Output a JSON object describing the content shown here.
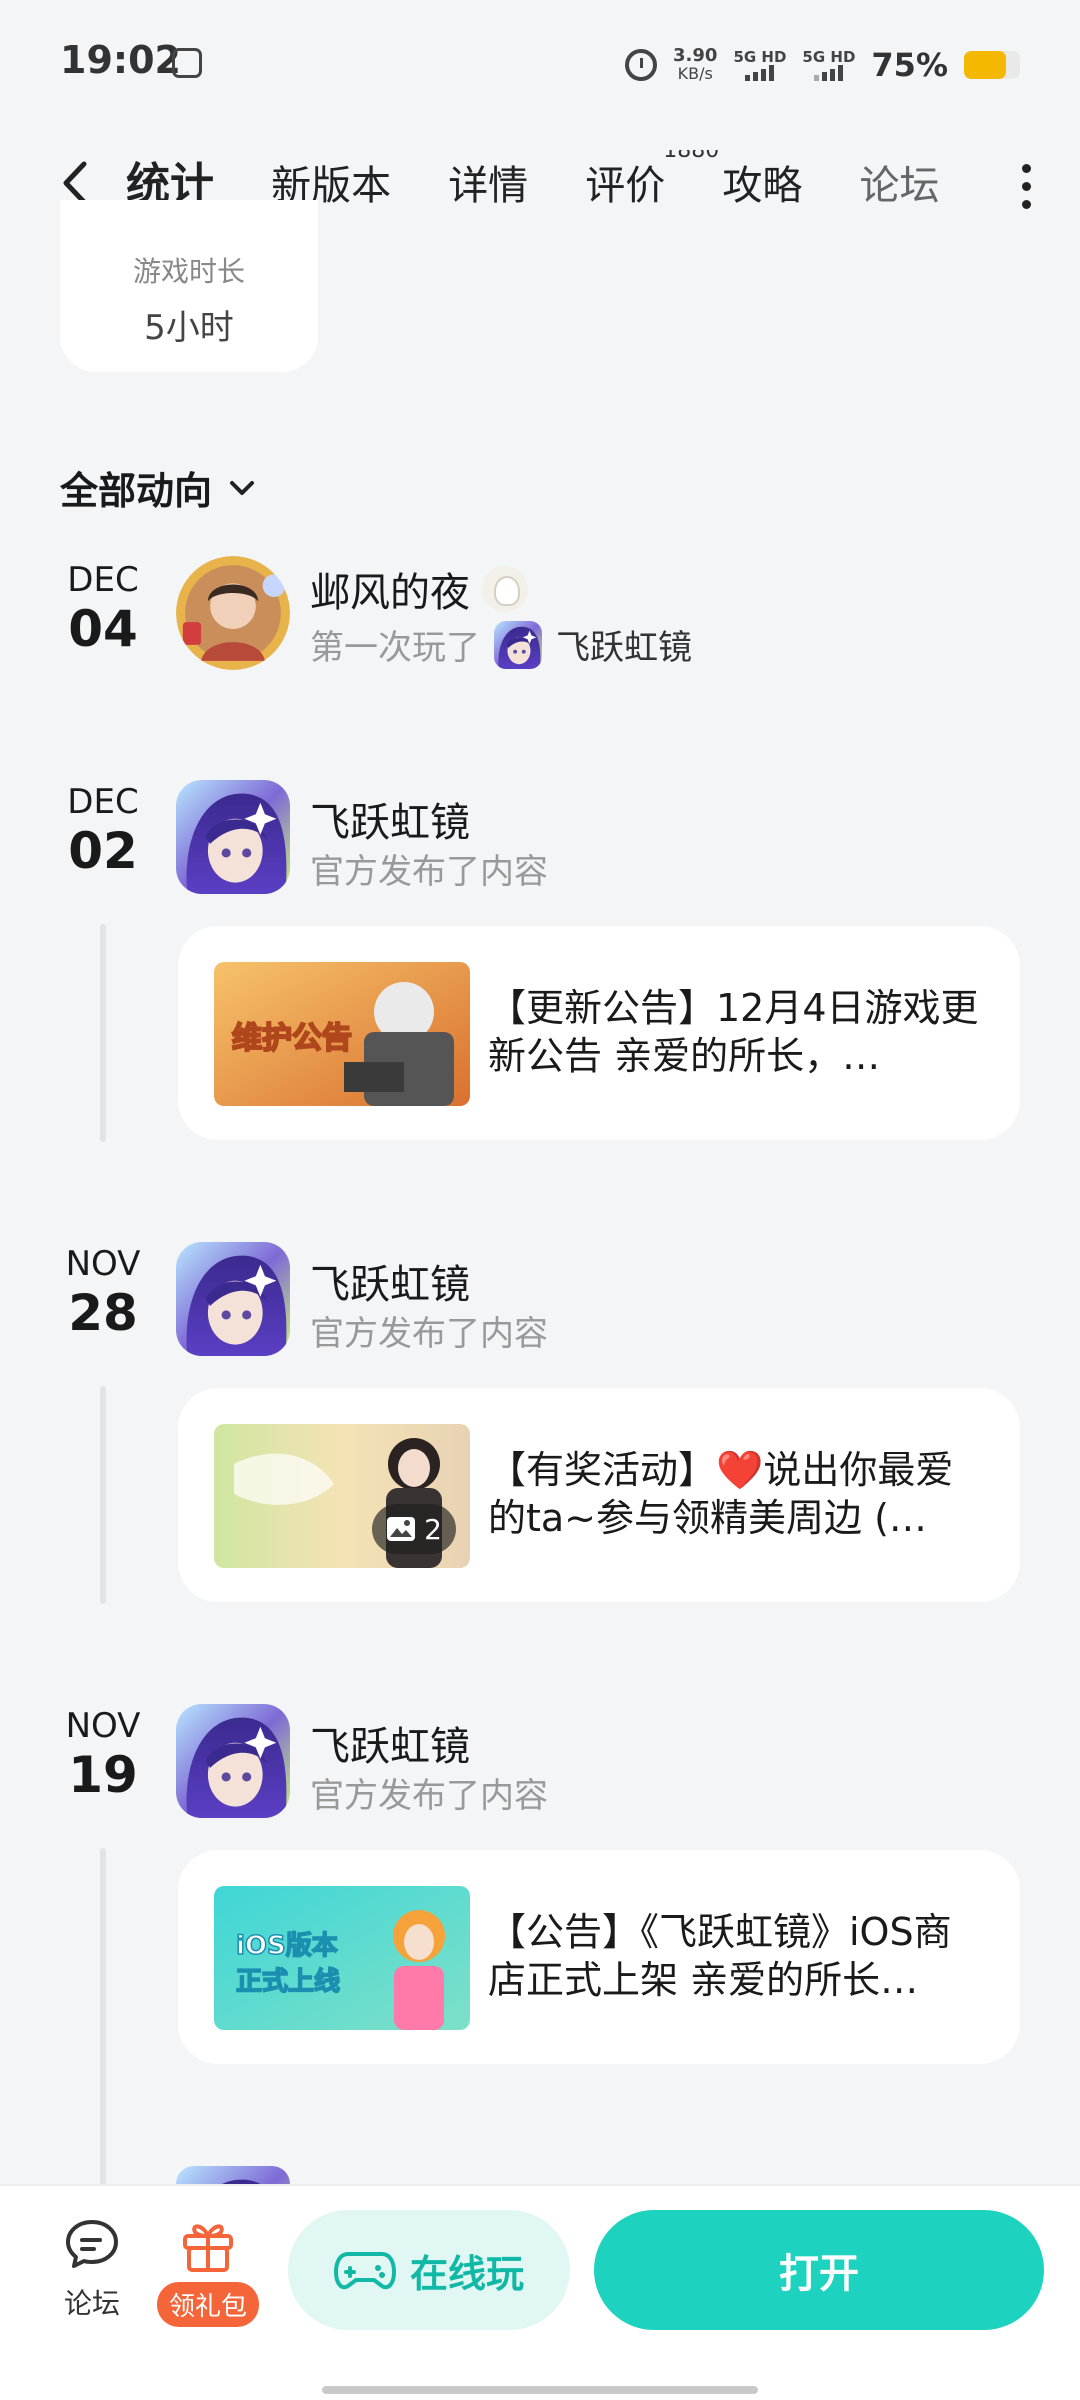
{
  "status_bar": {
    "time": "19:02",
    "speed_value": "3.90",
    "speed_unit": "KB/s",
    "sim1_label": "5G HD",
    "sim2_label": "5G HD",
    "battery_percent": "75%",
    "battery_level": 0.75,
    "battery_color": "#f5b800",
    "icons": [
      "app-notification-icon",
      "alarm-icon",
      "signal-icon",
      "signal-icon",
      "battery-icon"
    ]
  },
  "nav": {
    "tabs": [
      {
        "label": "统计",
        "active": true
      },
      {
        "label": "新版本"
      },
      {
        "label": "详情"
      },
      {
        "label": "评价",
        "badge": "1880"
      },
      {
        "label": "攻略"
      },
      {
        "label": "论坛"
      }
    ],
    "accent_color": "#1cc9b8"
  },
  "stat": {
    "label": "游戏时长",
    "value": "5小时"
  },
  "filter": {
    "label": "全部动向"
  },
  "feed": [
    {
      "month": "DEC",
      "day": "04",
      "name": "邺风的夜",
      "action": "第一次玩了",
      "game": "飞跃虹镜"
    },
    {
      "month": "DEC",
      "day": "02",
      "name": "飞跃虹镜",
      "action": "官方发布了内容",
      "post_text": "【更新公告】12月4日游戏更新公告 亲爱的所长，…",
      "thumb_text": "维护公告"
    },
    {
      "month": "NOV",
      "day": "28",
      "name": "飞跃虹镜",
      "action": "官方发布了内容",
      "post_text": "【有奖活动】❤️说出你最爱的ta~参与领精美周边 (…",
      "image_count": "2"
    },
    {
      "month": "NOV",
      "day": "19",
      "name": "飞跃虹镜",
      "action": "官方发布了内容",
      "post_text": "【公告】《飞跃虹镜》iOS商店正式上架 亲爱的所长…",
      "thumb_text_line1": "iOS版本",
      "thumb_text_line2": "正式上线"
    }
  ],
  "bottom_bar": {
    "forum_label": "论坛",
    "gift_label": "领礼包",
    "online_label": "在线玩",
    "open_label": "打开",
    "open_color": "#1ed2c0",
    "gift_color": "#f4653a"
  }
}
